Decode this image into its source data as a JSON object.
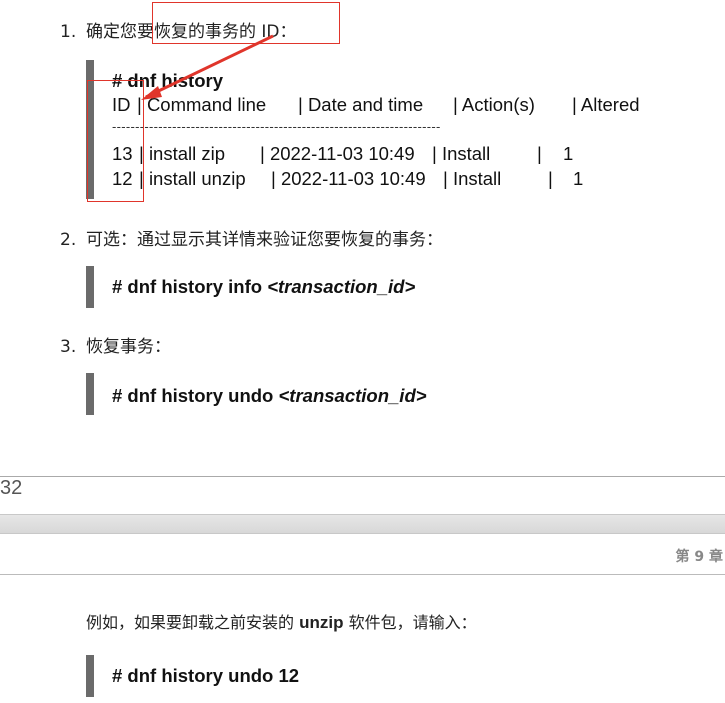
{
  "steps": [
    {
      "num": "1.",
      "text": "确定您要恢复的事务的 ID："
    },
    {
      "num": "2.",
      "text": "可选：通过显示其详情来验证您要恢复的事务："
    },
    {
      "num": "3.",
      "text": "恢复事务："
    }
  ],
  "history_block": {
    "prompt": "# dnf history",
    "header": {
      "id": "ID",
      "command": "| Command line",
      "date": "| Date and time",
      "action": "| Action(s)",
      "altered": "| Altered"
    },
    "separator": "-----------------------------------------------------------------------",
    "rows": [
      {
        "id": "13",
        "command": "| install zip",
        "date": "| 2022-11-03 10:49",
        "action": "| Install",
        "sep": "|",
        "altered": "1"
      },
      {
        "id": "12",
        "command": "| install unzip",
        "date": "| 2022-11-03 10:49",
        "action": "| Install",
        "sep": "|",
        "altered": "1"
      }
    ]
  },
  "info_cmd": {
    "prefix": "# dnf history info ",
    "arg": "<transaction_id>"
  },
  "undo_cmd": {
    "prefix": "# dnf history undo ",
    "arg": "<transaction_id>"
  },
  "page_number": "32",
  "chapter_label": "第 9 章",
  "example": {
    "before": "例如，如果要卸载之前安装的 ",
    "pkg": "unzip",
    "after": " 软件包，请输入："
  },
  "example_cmd": "# dnf history undo 12",
  "annotation_color": "#e0352b"
}
